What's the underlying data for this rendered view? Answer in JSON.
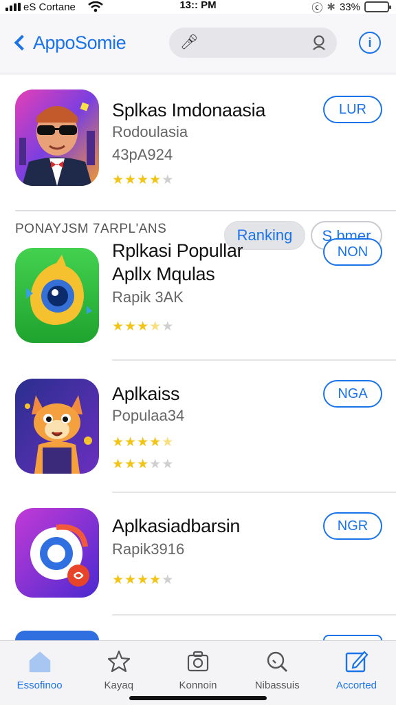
{
  "status_bar": {
    "carrier": "eS Cortane",
    "time": "13:: PM",
    "battery_text": "33%",
    "battery_level": 0.33
  },
  "nav": {
    "back_label": "AppoSomie",
    "search_placeholder": "",
    "info_glyph": "i"
  },
  "featured": {
    "name": "Splkas Imdonaasia",
    "subtitle": "Rodoulasia",
    "meta": "43pA924",
    "rating": 4,
    "button": "LUR",
    "chips": [
      "Ranking",
      "S bmer"
    ]
  },
  "section_label": "PONAYJSM 7ARPL'ANS",
  "apps": [
    {
      "name_line1": "Rplkasi Popullar",
      "name_line2": "Apllx Mqulas",
      "subtitle": "Rapik 3AK",
      "rating": 3.5,
      "button": "NON"
    },
    {
      "name_line1": "Aplkaiss",
      "subtitle": "Populaa34",
      "rating": 4.5,
      "rating2": 3,
      "button": "NGA"
    },
    {
      "name_line1": "Aplkasiadbarsin",
      "subtitle": "Rapik3916",
      "rating": 4,
      "button": "NGR"
    }
  ],
  "tabs": [
    {
      "label": "Essofinoo",
      "icon": "home-icon",
      "active": true
    },
    {
      "label": "Kayaq",
      "icon": "star-icon",
      "active": false
    },
    {
      "label": "Konnoin",
      "icon": "camera-icon",
      "active": false
    },
    {
      "label": "Nibassuis",
      "icon": "search-icon",
      "active": false
    },
    {
      "label": "Accorted",
      "icon": "edit-icon",
      "active": false
    }
  ],
  "colors": {
    "accent": "#1a73e8",
    "star": "#f2c417",
    "star_off": "#cfcfcf"
  }
}
